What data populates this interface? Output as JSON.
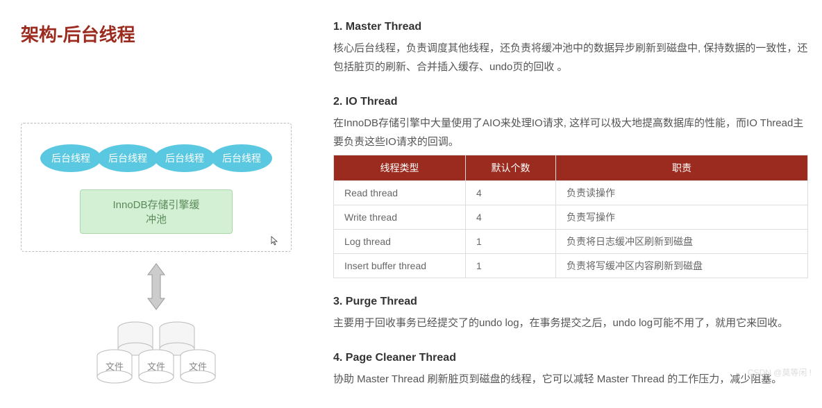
{
  "title": "架构-后台线程",
  "diagram": {
    "threads": [
      "后台线程",
      "后台线程",
      "后台线程",
      "后台线程"
    ],
    "buffer": "InnoDB存储引擎缓冲池",
    "file_label": "文件"
  },
  "sections": {
    "master": {
      "title": "1. Master Thread",
      "text": "核心后台线程，负责调度其他线程，还负责将缓冲池中的数据异步刷新到磁盘中, 保持数据的一致性，还包括脏页的刷新、合并插入缓存、undo页的回收 。"
    },
    "io": {
      "title": "2. IO Thread",
      "text": "在InnoDB存储引擎中大量使用了AIO来处理IO请求, 这样可以极大地提高数据库的性能，而IO Thread主要负责这些IO请求的回调。",
      "headers": [
        "线程类型",
        "默认个数",
        "职责"
      ],
      "rows": [
        [
          "Read thread",
          "4",
          "负责读操作"
        ],
        [
          "Write thread",
          "4",
          "负责写操作"
        ],
        [
          "Log thread",
          "1",
          "负责将日志缓冲区刷新到磁盘"
        ],
        [
          "Insert buffer thread",
          "1",
          "负责将写缓冲区内容刷新到磁盘"
        ]
      ]
    },
    "purge": {
      "title": "3. Purge Thread",
      "text": "主要用于回收事务已经提交了的undo log，在事务提交之后，undo log可能不用了，就用它来回收。"
    },
    "cleaner": {
      "title": "4. Page Cleaner Thread",
      "text": "协助 Master Thread 刷新脏页到磁盘的线程，它可以减轻 Master Thread 的工作压力，减少阻塞。"
    }
  },
  "watermark": "CSDN @莫等闲 !"
}
